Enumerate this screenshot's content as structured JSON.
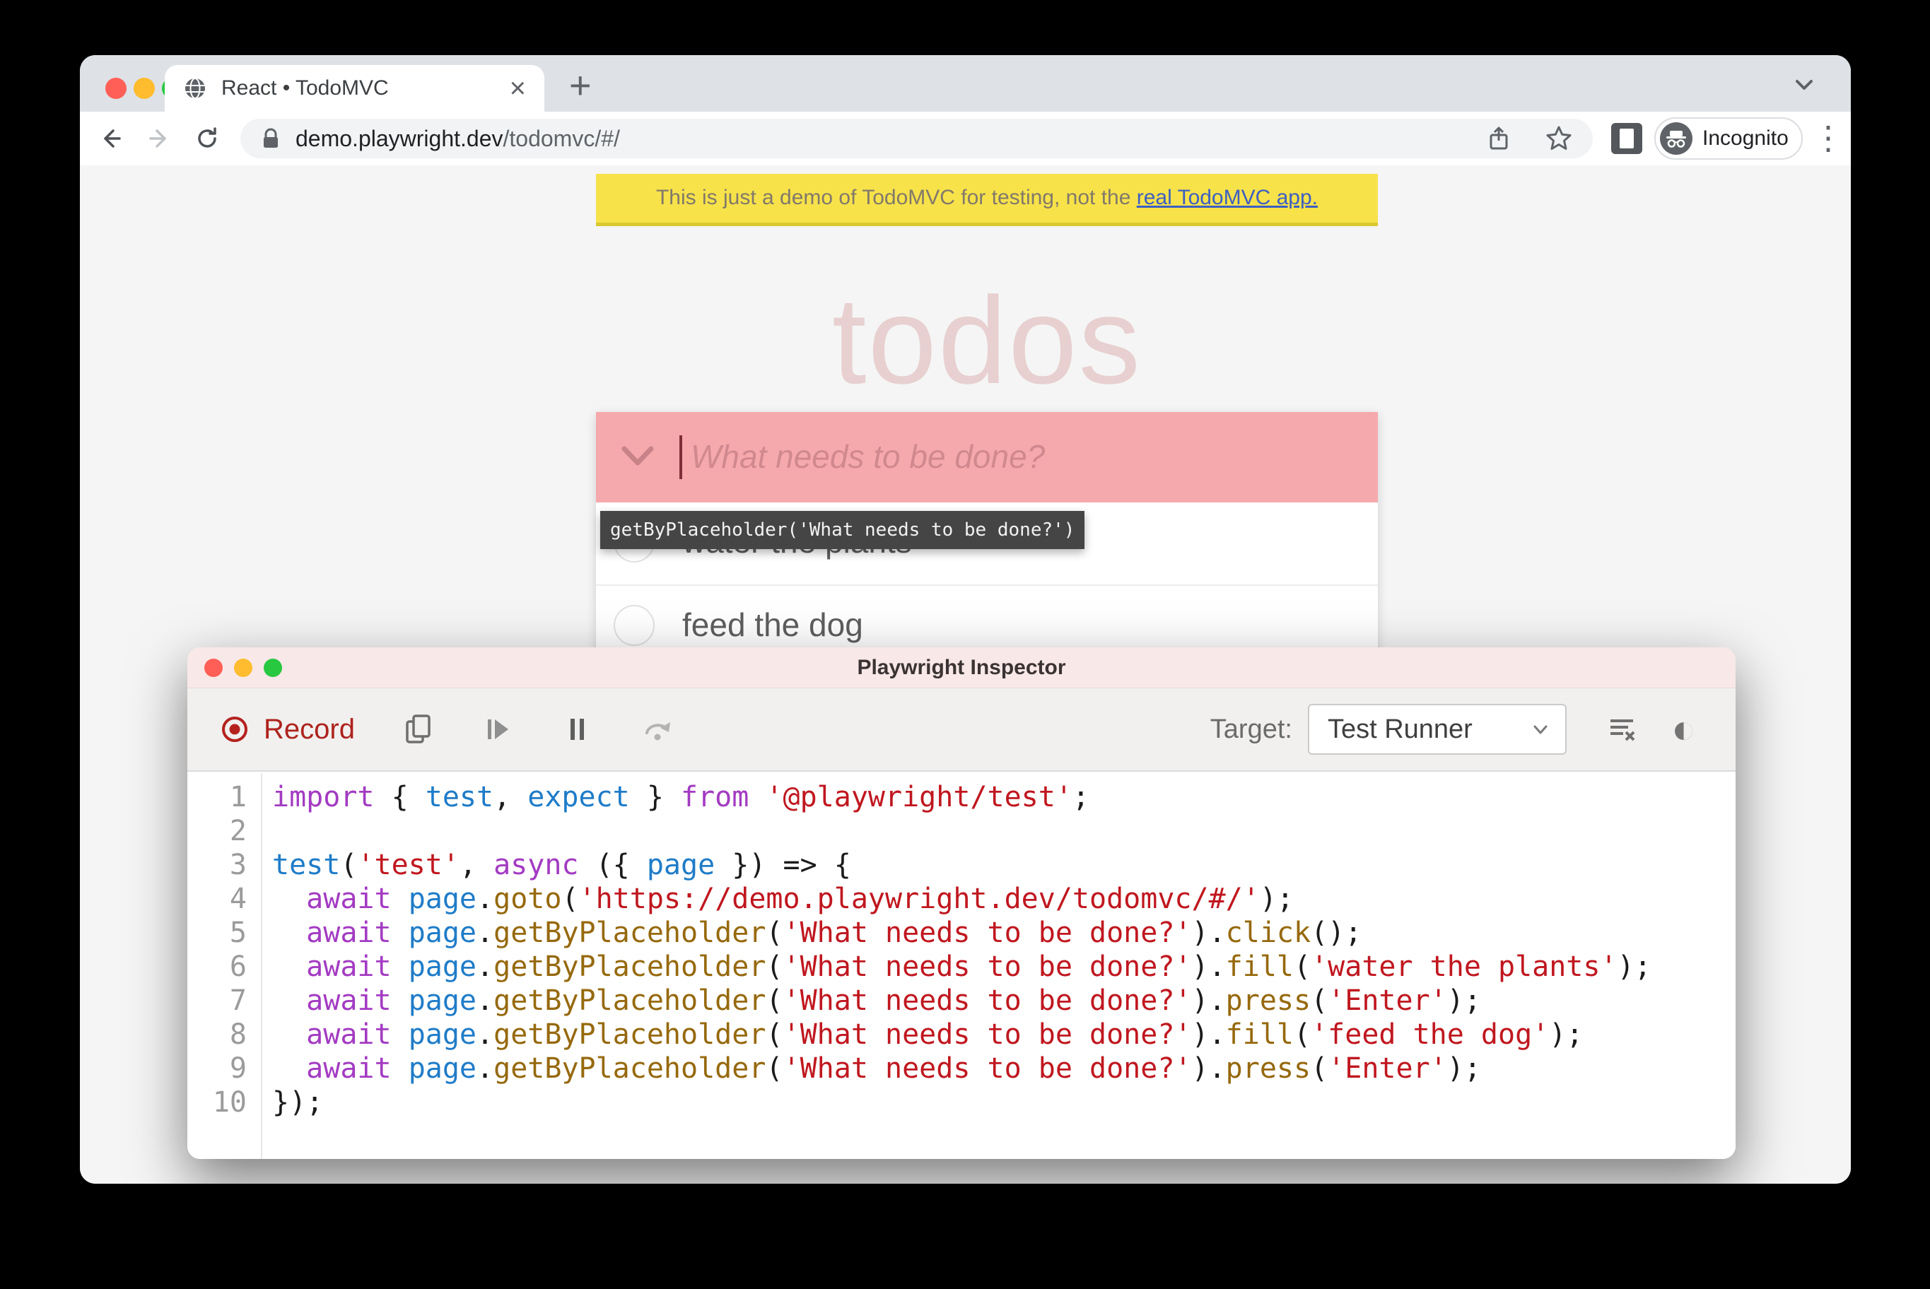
{
  "browser": {
    "tab": {
      "title": "React • TodoMVC"
    },
    "glyphs": {
      "close": "×",
      "new_tab": "+",
      "kebab": "⋮"
    },
    "toolbar": {
      "url_host": "demo.playwright.dev",
      "url_path": "/todomvc/#/",
      "incognito_label": "Incognito"
    }
  },
  "page": {
    "banner": {
      "prefix": "This is just a demo of TodoMVC for testing, not the ",
      "link_label": "real TodoMVC app."
    },
    "heading": "todos",
    "new_todo_placeholder": "What needs to be done?",
    "inspector_tooltip": "getByPlaceholder('What needs to be done?')",
    "todos": [
      "water the plants",
      "feed the dog"
    ]
  },
  "inspector": {
    "title": "Playwright Inspector",
    "toolbar": {
      "record_label": "Record",
      "target_label": "Target:",
      "target_value": "Test Runner",
      "contrast_glyph": "◐"
    },
    "code_lines": [
      {
        "n": "1",
        "t": [
          [
            "kw",
            "import"
          ],
          [
            "pu",
            " { "
          ],
          [
            "df",
            "test"
          ],
          [
            "pu",
            ", "
          ],
          [
            "df",
            "expect"
          ],
          [
            "pu",
            " } "
          ],
          [
            "kw",
            "from"
          ],
          [
            "pu",
            " "
          ],
          [
            "st",
            "'@playwright/test'"
          ],
          [
            "pu",
            ";"
          ]
        ]
      },
      {
        "n": "2",
        "t": []
      },
      {
        "n": "3",
        "t": [
          [
            "df",
            "test"
          ],
          [
            "pu",
            "("
          ],
          [
            "st",
            "'test'"
          ],
          [
            "pu",
            ", "
          ],
          [
            "kw",
            "async"
          ],
          [
            "pu",
            " ({ "
          ],
          [
            "df",
            "page"
          ],
          [
            "pu",
            " }) => {"
          ]
        ]
      },
      {
        "n": "4",
        "t": [
          [
            "pu",
            "  "
          ],
          [
            "kw",
            "await"
          ],
          [
            "pu",
            " "
          ],
          [
            "df",
            "page"
          ],
          [
            "pu",
            "."
          ],
          [
            "mt",
            "goto"
          ],
          [
            "pu",
            "("
          ],
          [
            "st",
            "'https://demo.playwright.dev/todomvc/#/'"
          ],
          [
            "pu",
            ");"
          ]
        ]
      },
      {
        "n": "5",
        "t": [
          [
            "pu",
            "  "
          ],
          [
            "kw",
            "await"
          ],
          [
            "pu",
            " "
          ],
          [
            "df",
            "page"
          ],
          [
            "pu",
            "."
          ],
          [
            "mt",
            "getByPlaceholder"
          ],
          [
            "pu",
            "("
          ],
          [
            "st",
            "'What needs to be done?'"
          ],
          [
            "pu",
            ")."
          ],
          [
            "mt",
            "click"
          ],
          [
            "pu",
            "();"
          ]
        ]
      },
      {
        "n": "6",
        "t": [
          [
            "pu",
            "  "
          ],
          [
            "kw",
            "await"
          ],
          [
            "pu",
            " "
          ],
          [
            "df",
            "page"
          ],
          [
            "pu",
            "."
          ],
          [
            "mt",
            "getByPlaceholder"
          ],
          [
            "pu",
            "("
          ],
          [
            "st",
            "'What needs to be done?'"
          ],
          [
            "pu",
            ")."
          ],
          [
            "mt",
            "fill"
          ],
          [
            "pu",
            "("
          ],
          [
            "st",
            "'water the plants'"
          ],
          [
            "pu",
            ");"
          ]
        ]
      },
      {
        "n": "7",
        "t": [
          [
            "pu",
            "  "
          ],
          [
            "kw",
            "await"
          ],
          [
            "pu",
            " "
          ],
          [
            "df",
            "page"
          ],
          [
            "pu",
            "."
          ],
          [
            "mt",
            "getByPlaceholder"
          ],
          [
            "pu",
            "("
          ],
          [
            "st",
            "'What needs to be done?'"
          ],
          [
            "pu",
            ")."
          ],
          [
            "mt",
            "press"
          ],
          [
            "pu",
            "("
          ],
          [
            "st",
            "'Enter'"
          ],
          [
            "pu",
            ");"
          ]
        ]
      },
      {
        "n": "8",
        "t": [
          [
            "pu",
            "  "
          ],
          [
            "kw",
            "await"
          ],
          [
            "pu",
            " "
          ],
          [
            "df",
            "page"
          ],
          [
            "pu",
            "."
          ],
          [
            "mt",
            "getByPlaceholder"
          ],
          [
            "pu",
            "("
          ],
          [
            "st",
            "'What needs to be done?'"
          ],
          [
            "pu",
            ")."
          ],
          [
            "mt",
            "fill"
          ],
          [
            "pu",
            "("
          ],
          [
            "st",
            "'feed the dog'"
          ],
          [
            "pu",
            ");"
          ]
        ]
      },
      {
        "n": "9",
        "t": [
          [
            "pu",
            "  "
          ],
          [
            "kw",
            "await"
          ],
          [
            "pu",
            " "
          ],
          [
            "df",
            "page"
          ],
          [
            "pu",
            "."
          ],
          [
            "mt",
            "getByPlaceholder"
          ],
          [
            "pu",
            "("
          ],
          [
            "st",
            "'What needs to be done?'"
          ],
          [
            "pu",
            ")."
          ],
          [
            "mt",
            "press"
          ],
          [
            "pu",
            "("
          ],
          [
            "st",
            "'Enter'"
          ],
          [
            "pu",
            ");"
          ]
        ]
      },
      {
        "n": "10",
        "t": [
          [
            "pu",
            "});"
          ]
        ]
      }
    ]
  },
  "colors": {
    "highlight_pink": "#F6A9AD",
    "banner_yellow": "#F7E24A",
    "record_red": "#AE231D",
    "tooltip_bg": "#454545",
    "code_keyword": "#A33BC2",
    "code_identifier": "#1F7CC8",
    "code_string": "#C0171F",
    "code_method": "#96690D"
  }
}
